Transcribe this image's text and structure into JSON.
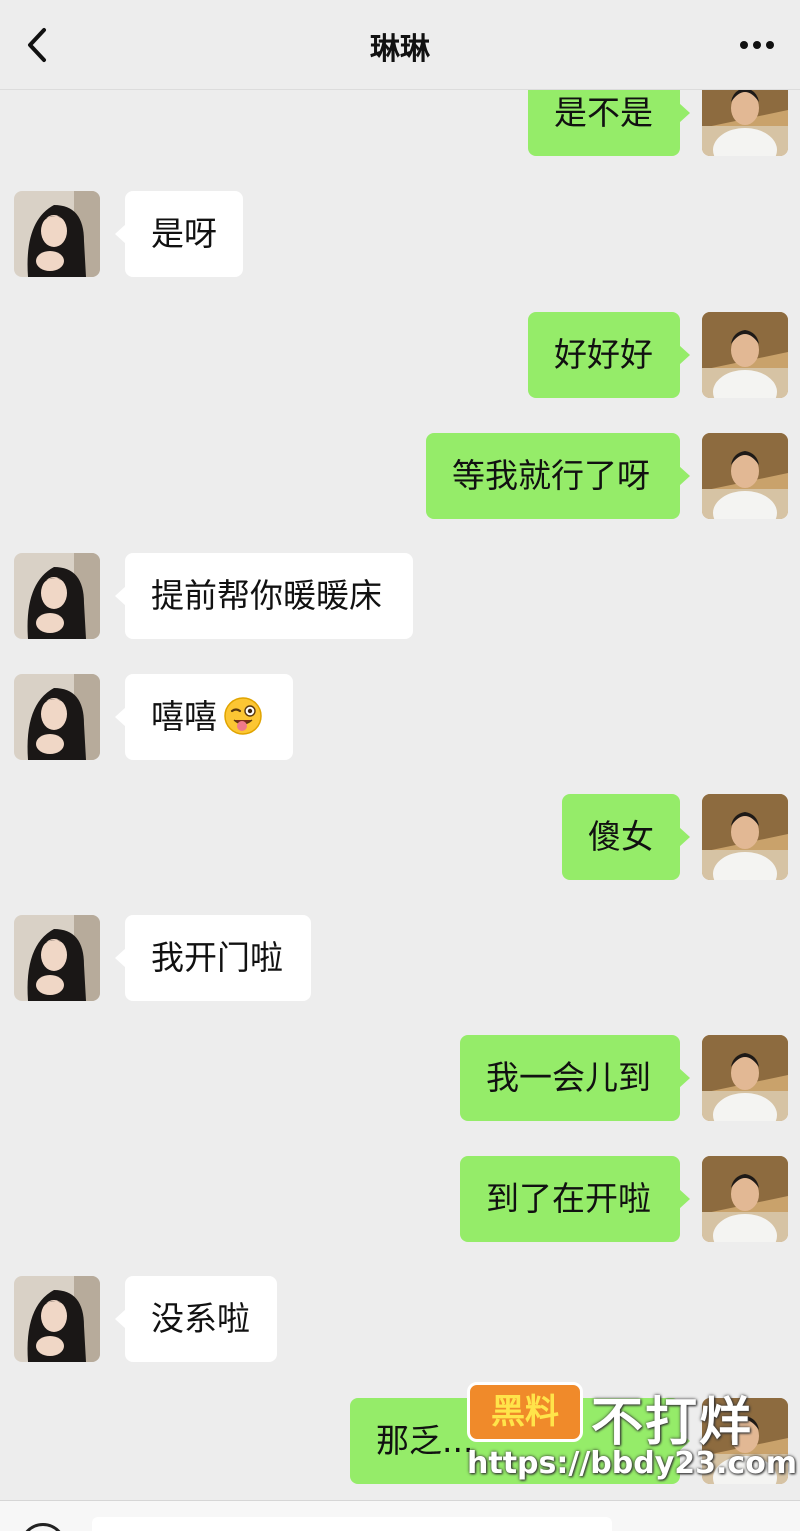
{
  "header": {
    "title": "琳琳",
    "back_icon": "chevron-left-icon",
    "more_icon": "more-dots-icon"
  },
  "messages": [
    {
      "side": "right",
      "text": "是不是"
    },
    {
      "side": "left",
      "text": "是呀"
    },
    {
      "side": "right",
      "text": "好好好"
    },
    {
      "side": "right",
      "text": "等我就行了呀"
    },
    {
      "side": "left",
      "text": "提前帮你暖暖床"
    },
    {
      "side": "left",
      "text": "嘻嘻",
      "emoji": "tongue-wink-emoji"
    },
    {
      "side": "right",
      "text": "傻女"
    },
    {
      "side": "left",
      "text": "我开门啦"
    },
    {
      "side": "right",
      "text": "我一会儿到"
    },
    {
      "side": "right",
      "text": "到了在开啦"
    },
    {
      "side": "left",
      "text": "没系啦"
    },
    {
      "side": "right",
      "text": "那乏..."
    }
  ],
  "watermark": {
    "badge": "黑料",
    "big": "不打烊",
    "url": "https://bbdy23.com"
  },
  "colors": {
    "background": "#ededed",
    "self_bubble": "#95ec69",
    "other_bubble": "#ffffff",
    "watermark_badge": "#f08a2a"
  }
}
